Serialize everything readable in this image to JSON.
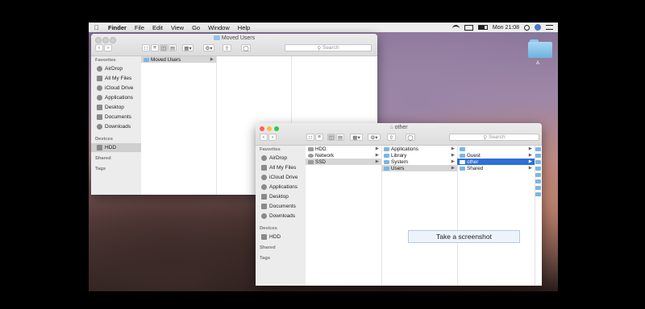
{
  "menubar": {
    "apple": "",
    "app": "Finder",
    "items": [
      "File",
      "Edit",
      "View",
      "Go",
      "Window",
      "Help"
    ],
    "clock": "Mon 21:08"
  },
  "desktop": {
    "folder_label": "A"
  },
  "window1": {
    "title": "Moved Users",
    "search_placeholder": "Search",
    "sidebar": {
      "favorites_heading": "Favorites",
      "favorites": [
        "AirDrop",
        "All My Files",
        "iCloud Drive",
        "Applications",
        "Desktop",
        "Documents",
        "Downloads"
      ],
      "devices_heading": "Devices",
      "devices": [
        "HDD"
      ],
      "shared_heading": "Shared",
      "tags_heading": "Tags"
    },
    "column1": [
      "Moved Users"
    ]
  },
  "window2": {
    "title": "other",
    "search_placeholder": "Search",
    "sidebar": {
      "favorites_heading": "Favorites",
      "favorites": [
        "AirDrop",
        "All My Files",
        "iCloud Drive",
        "Applications",
        "Desktop",
        "Documents",
        "Downloads"
      ],
      "devices_heading": "Devices",
      "devices": [
        "HDD"
      ],
      "shared_heading": "Shared",
      "tags_heading": "Tags"
    },
    "column1": [
      "HDD",
      "Network",
      "SSD"
    ],
    "column2": [
      "Applications",
      "Library",
      "System",
      "Users"
    ],
    "column3": [
      "",
      "Guest",
      "other",
      "Shared"
    ]
  },
  "tooltip": "Take a screenshot",
  "colors": {
    "selection": "#2f6fd6",
    "traffic_red": "#fc605c",
    "traffic_yellow": "#fdbc40",
    "traffic_green": "#34c84a"
  }
}
